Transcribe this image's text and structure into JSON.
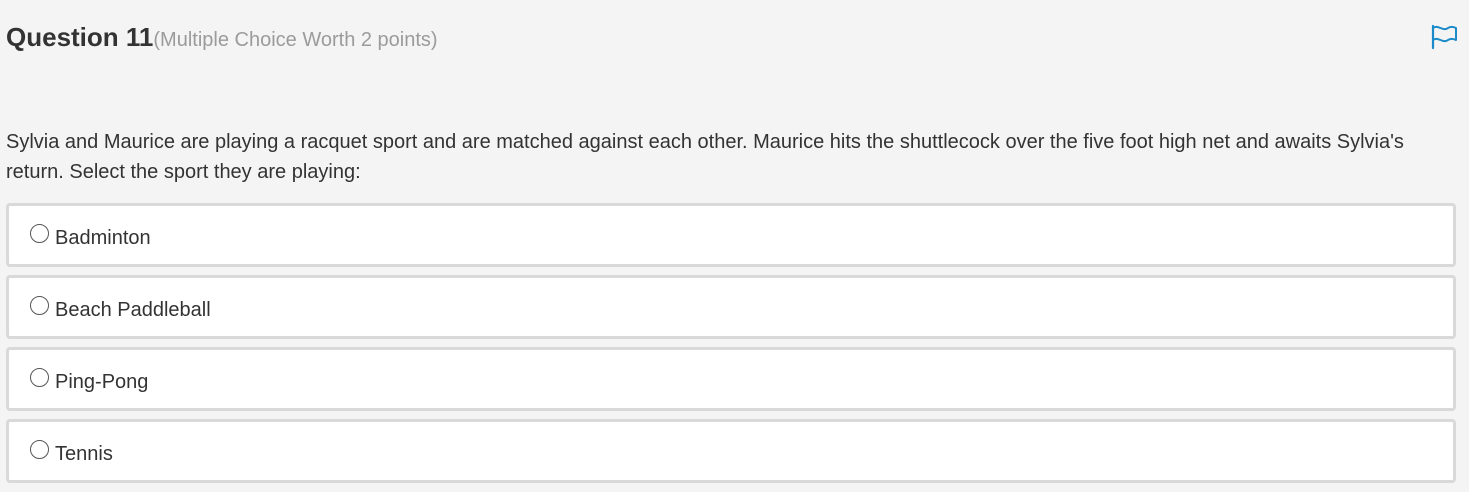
{
  "question": {
    "title": "Question 11",
    "meta": "(Multiple Choice Worth 2 points)",
    "prompt": "Sylvia and Maurice are playing a racquet sport and are matched against each other. Maurice hits the shuttlecock over the five foot high net and awaits Sylvia's return. Select the sport they are playing:",
    "flag_icon": "flag-icon",
    "accent_color": "#1a8ac8"
  },
  "options": [
    {
      "label": "Badminton",
      "selected": false
    },
    {
      "label": "Beach Paddleball",
      "selected": false
    },
    {
      "label": "Ping-Pong",
      "selected": false
    },
    {
      "label": "Tennis",
      "selected": false
    }
  ]
}
